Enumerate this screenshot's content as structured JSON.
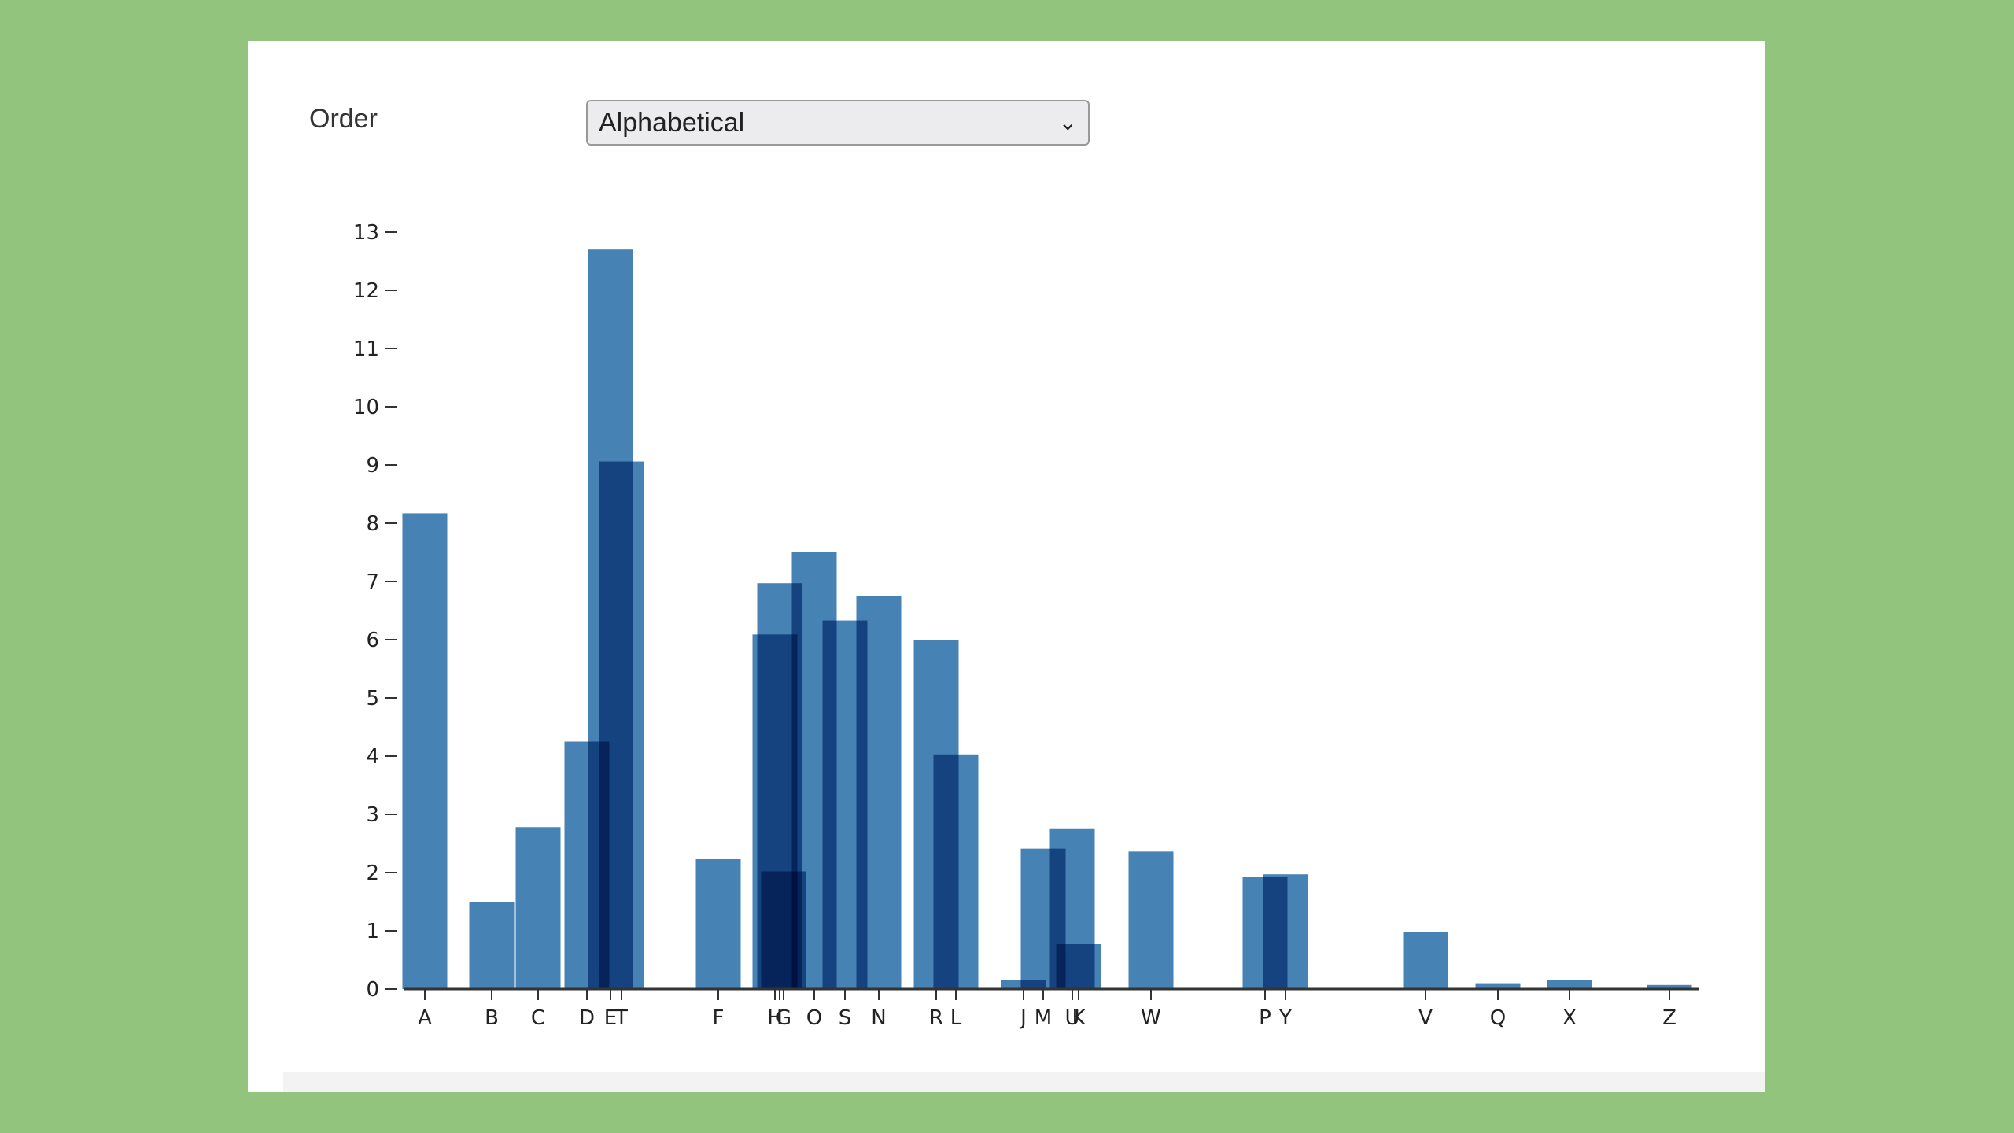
{
  "controls": {
    "order_label": "Order",
    "order_value": "Alphabetical"
  },
  "colors": {
    "background": "#93c47d",
    "bar": "#4682b4"
  },
  "chart_data": {
    "type": "bar",
    "title": "",
    "xlabel": "",
    "ylabel": "",
    "ylim": [
      0,
      13
    ],
    "yticks": [
      0,
      1,
      2,
      3,
      4,
      5,
      6,
      7,
      8,
      9,
      10,
      11,
      12,
      13
    ],
    "categories": [
      "A",
      "B",
      "C",
      "D",
      "E",
      "F",
      "G",
      "H",
      "I",
      "J",
      "K",
      "L",
      "M",
      "N",
      "O",
      "P",
      "Q",
      "R",
      "S",
      "T",
      "U",
      "V",
      "W",
      "X",
      "Y",
      "Z"
    ],
    "values": [
      8.17,
      1.49,
      2.78,
      4.25,
      12.7,
      2.23,
      2.02,
      6.09,
      6.97,
      0.15,
      0.77,
      4.03,
      2.41,
      6.75,
      7.51,
      1.93,
      0.1,
      5.99,
      6.33,
      9.06,
      2.76,
      0.98,
      2.36,
      0.15,
      1.97,
      0.07
    ],
    "grid": false
  }
}
